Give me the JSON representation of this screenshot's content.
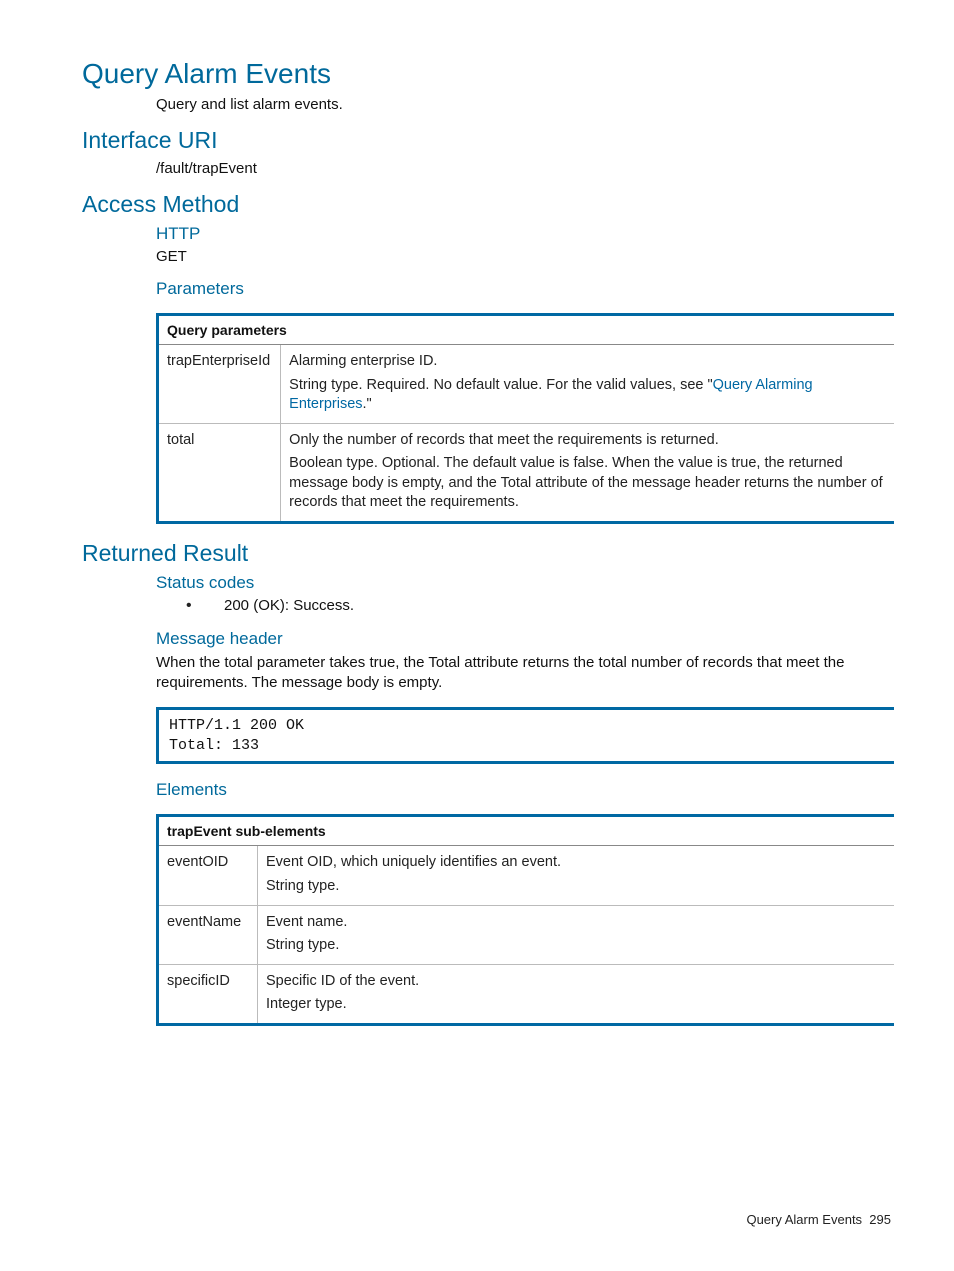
{
  "title": "Query Alarm Events",
  "description": "Query and list alarm events.",
  "interface_uri": {
    "heading": "Interface URI",
    "value": "/fault/trapEvent"
  },
  "access_method": {
    "heading": "Access Method",
    "http_heading": "HTTP",
    "http_method": "GET",
    "parameters_heading": "Parameters",
    "table_header": "Query parameters",
    "rows": [
      {
        "name": "trapEnterpriseId",
        "line1": "Alarming enterprise ID.",
        "line2_pre": "String type. Required. No default value. For the valid values, see \"",
        "line2_link": "Query Alarming Enterprises",
        "line2_post": ".\""
      },
      {
        "name": "total",
        "line1": "Only the number of records that meet the requirements is returned.",
        "line2": "Boolean type. Optional. The default value is false. When the value is true, the returned message body is empty, and the Total attribute of the message header returns the number of records that meet the requirements."
      }
    ]
  },
  "returned_result": {
    "heading": "Returned Result",
    "status_codes_heading": "Status codes",
    "status_codes": [
      "200 (OK): Success."
    ],
    "message_header_heading": "Message header",
    "message_header_text": "When the total parameter takes true, the Total attribute returns the total number of records that meet the requirements. The message body is empty.",
    "code_sample": "HTTP/1.1 200 OK\nTotal: 133",
    "elements_heading": "Elements",
    "elements_table_header": "trapEvent sub-elements",
    "elements_rows": [
      {
        "name": "eventOID",
        "line1": "Event OID, which uniquely identifies an event.",
        "line2": "String type."
      },
      {
        "name": "eventName",
        "line1": "Event name.",
        "line2": "String type."
      },
      {
        "name": "specificID",
        "line1": "Specific ID of the event.",
        "line2": "Integer type."
      }
    ]
  },
  "footer": {
    "label": "Query Alarm Events",
    "page": "295"
  }
}
